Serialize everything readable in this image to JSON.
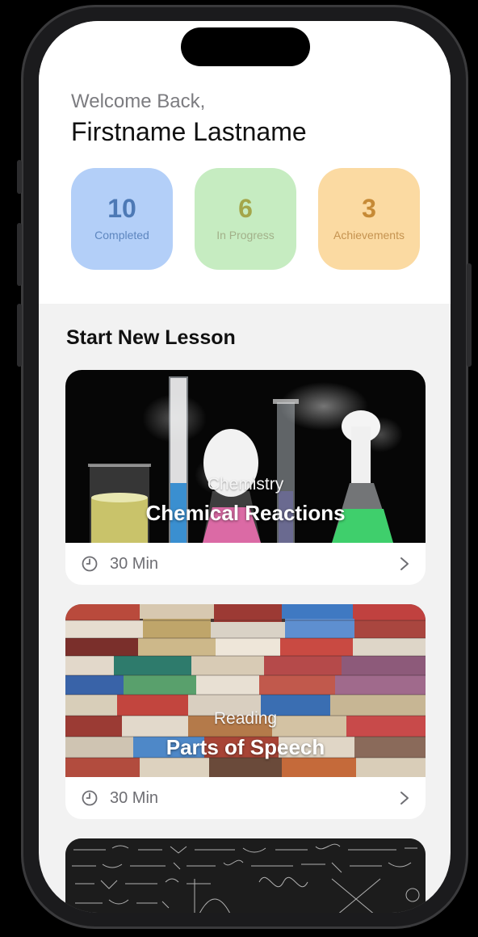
{
  "header": {
    "welcome": "Welcome Back,",
    "name": "Firstname Lastname"
  },
  "stats": [
    {
      "value": "10",
      "label": "Completed"
    },
    {
      "value": "6",
      "label": "In Progress"
    },
    {
      "value": "3",
      "label": "Achievements"
    }
  ],
  "section": {
    "title": "Start New Lesson"
  },
  "lessons": [
    {
      "subject": "Chemistry",
      "title": "Chemical Reactions",
      "duration": "30 Min",
      "image": "chemistry-glassware-image"
    },
    {
      "subject": "Reading",
      "title": "Parts of Speech",
      "duration": "30 Min",
      "image": "book-stacks-image"
    },
    {
      "image": "math-formulas-chalkboard-image"
    }
  ],
  "icons": {
    "clock": "clock-icon",
    "chevron": "chevron-right-icon"
  },
  "colors": {
    "completed": "#b3cff8",
    "in_progress": "#c6ecc1",
    "achievements": "#fbdaa2",
    "background": "#f2f2f2"
  }
}
